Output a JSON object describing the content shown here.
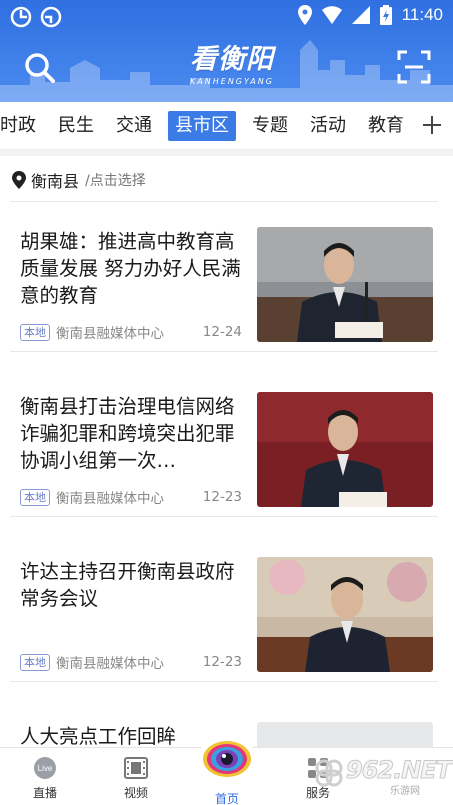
{
  "statusbar": {
    "time": "11:40"
  },
  "header": {
    "logo_text": "看衡阳",
    "logo_sub": "KANHENGYANG"
  },
  "tabs": [
    {
      "label": "时政",
      "active": false
    },
    {
      "label": "民生",
      "active": false
    },
    {
      "label": "交通",
      "active": false
    },
    {
      "label": "县市区",
      "active": true
    },
    {
      "label": "专题",
      "active": false
    },
    {
      "label": "活动",
      "active": false
    },
    {
      "label": "教育",
      "active": false
    }
  ],
  "location": {
    "name": "衡南县",
    "hint": "/点击选择"
  },
  "articles": [
    {
      "title": "胡果雄：推进高中教育高质量发展 努力办好人民满意的教育",
      "tag": "本地",
      "source": "衡南县融媒体中心",
      "date": "12-24"
    },
    {
      "title": "衡南县打击治理电信网络诈骗犯罪和跨境突出犯罪协调小组第一次…",
      "tag": "本地",
      "source": "衡南县融媒体中心",
      "date": "12-23"
    },
    {
      "title": "许达主持召开衡南县政府常务会议",
      "tag": "本地",
      "source": "衡南县融媒体中心",
      "date": "12-23"
    },
    {
      "title": "人大亮点工作回眸"
    }
  ],
  "bottom_nav": {
    "live": "直播",
    "video": "视频",
    "home": "首页",
    "service": "服务"
  },
  "watermark": {
    "text": "962.NET",
    "sub": "乐游网"
  },
  "colors": {
    "brand_blue": "#2f6fe0",
    "active_tab": "#3a7be6",
    "tag_border": "#8a9ad6"
  }
}
